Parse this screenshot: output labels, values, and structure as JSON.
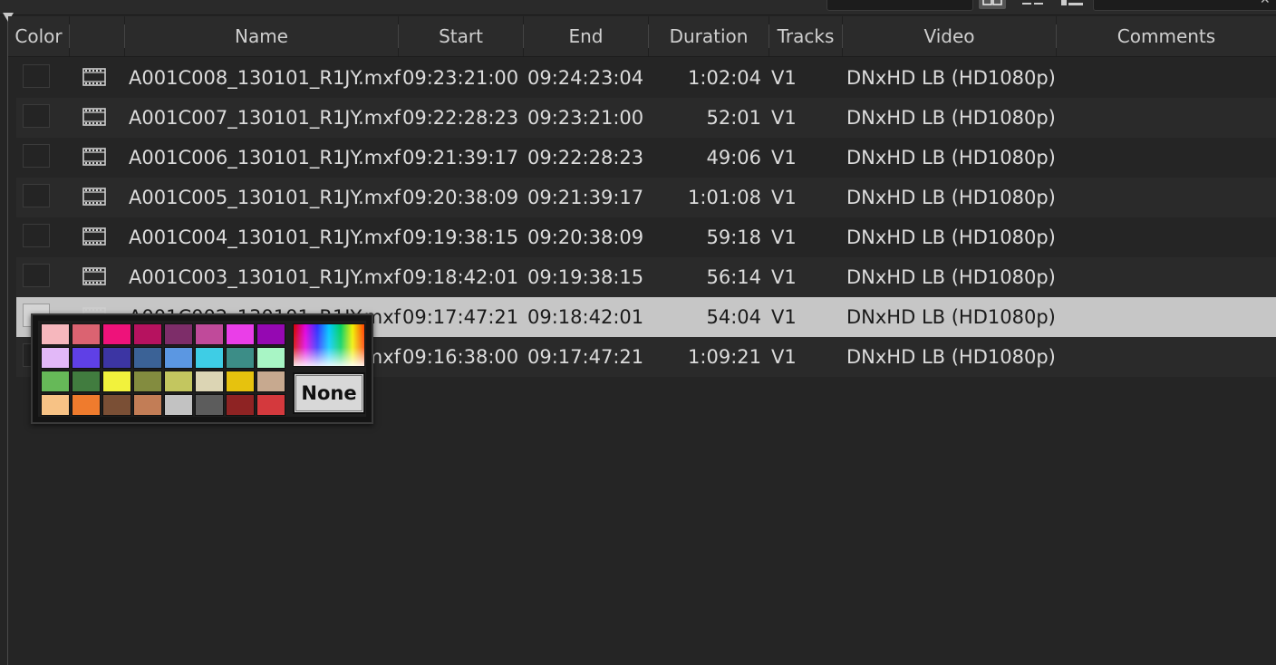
{
  "columns": {
    "color": "Color",
    "name": "Name",
    "start": "Start",
    "end": "End",
    "duration": "Duration",
    "tracks": "Tracks",
    "video": "Video",
    "comments": "Comments"
  },
  "clips": [
    {
      "name": "A001C008_130101_R1JY.mxf",
      "start": "09:23:21:00",
      "end": "09:24:23:04",
      "duration": "1:02:04",
      "tracks": "V1",
      "video": "DNxHD LB (HD1080p)"
    },
    {
      "name": "A001C007_130101_R1JY.mxf",
      "start": "09:22:28:23",
      "end": "09:23:21:00",
      "duration": "52:01",
      "tracks": "V1",
      "video": "DNxHD LB (HD1080p)"
    },
    {
      "name": "A001C006_130101_R1JY.mxf",
      "start": "09:21:39:17",
      "end": "09:22:28:23",
      "duration": "49:06",
      "tracks": "V1",
      "video": "DNxHD LB (HD1080p)"
    },
    {
      "name": "A001C005_130101_R1JY.mxf",
      "start": "09:20:38:09",
      "end": "09:21:39:17",
      "duration": "1:01:08",
      "tracks": "V1",
      "video": "DNxHD LB (HD1080p)"
    },
    {
      "name": "A001C004_130101_R1JY.mxf",
      "start": "09:19:38:15",
      "end": "09:20:38:09",
      "duration": "59:18",
      "tracks": "V1",
      "video": "DNxHD LB (HD1080p)"
    },
    {
      "name": "A001C003_130101_R1JY.mxf",
      "start": "09:18:42:01",
      "end": "09:19:38:15",
      "duration": "56:14",
      "tracks": "V1",
      "video": "DNxHD LB (HD1080p)"
    },
    {
      "name": "A001C002_130101_R1JY.mxf",
      "start": "09:17:47:21",
      "end": "09:18:42:01",
      "duration": "54:04",
      "tracks": "V1",
      "video": "DNxHD LB (HD1080p)",
      "selected": true
    },
    {
      "name": "A001C001_130101_R1JY.mxf",
      "start": "09:16:38:00",
      "end": "09:17:47:21",
      "duration": "1:09:21",
      "tracks": "V1",
      "video": "DNxHD LB (HD1080p)"
    }
  ],
  "color_picker": {
    "none_label": "None",
    "swatches": [
      "#f6b7bd",
      "#db6371",
      "#ee127a",
      "#b6125f",
      "#7d2d69",
      "#c04a9a",
      "#ea3ee8",
      "#9508b2",
      "#e2b8f8",
      "#5f40e6",
      "#3c35a3",
      "#3b6296",
      "#5b97e2",
      "#3ecde5",
      "#3c8d87",
      "#a8f5c5",
      "#66b958",
      "#417c3f",
      "#f2f23c",
      "#838c3f",
      "#c3c65f",
      "#dcd5b4",
      "#e6c20e",
      "#c7a98f",
      "#f7c285",
      "#ef7b2d",
      "#7a4f35",
      "#c27d56",
      "#c2c2c2",
      "#5c5c5c",
      "#8e2323",
      "#d4393d"
    ]
  },
  "icons": {
    "clip": "film-clip-icon",
    "view_grid": "thumbnail-view-icon",
    "view_list": "list-view-icon",
    "view_meta": "metadata-view-icon",
    "close": "close-icon"
  }
}
